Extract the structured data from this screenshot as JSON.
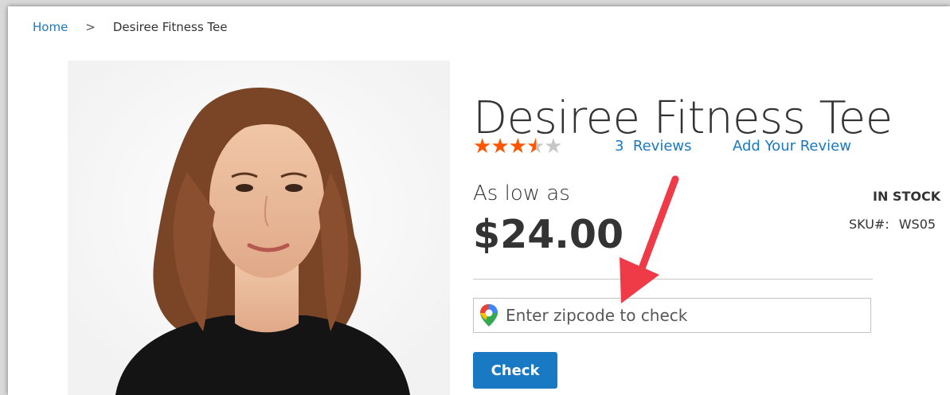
{
  "breadcrumb": {
    "home": "Home",
    "separator": ">",
    "current": "Desiree Fitness Tee"
  },
  "product": {
    "title": "Desiree Fitness Tee",
    "rating": {
      "stars_filled": 3.5,
      "stars_total": 5,
      "color": "#ff5501"
    },
    "reviews_link": "3  Reviews",
    "add_review_link": "Add Your Review",
    "price_prefix": "As low as",
    "price": "$24.00",
    "stock_status": "IN STOCK",
    "sku_label": "SKU#:",
    "sku_value": "WS05"
  },
  "zipcode": {
    "placeholder": "Enter zipcode to check",
    "icon": "map-pin-icon"
  },
  "check_button": {
    "label": "Check"
  },
  "colors": {
    "link": "#1979c3",
    "button": "#1979c3",
    "annotation_arrow": "#ef3b48"
  }
}
